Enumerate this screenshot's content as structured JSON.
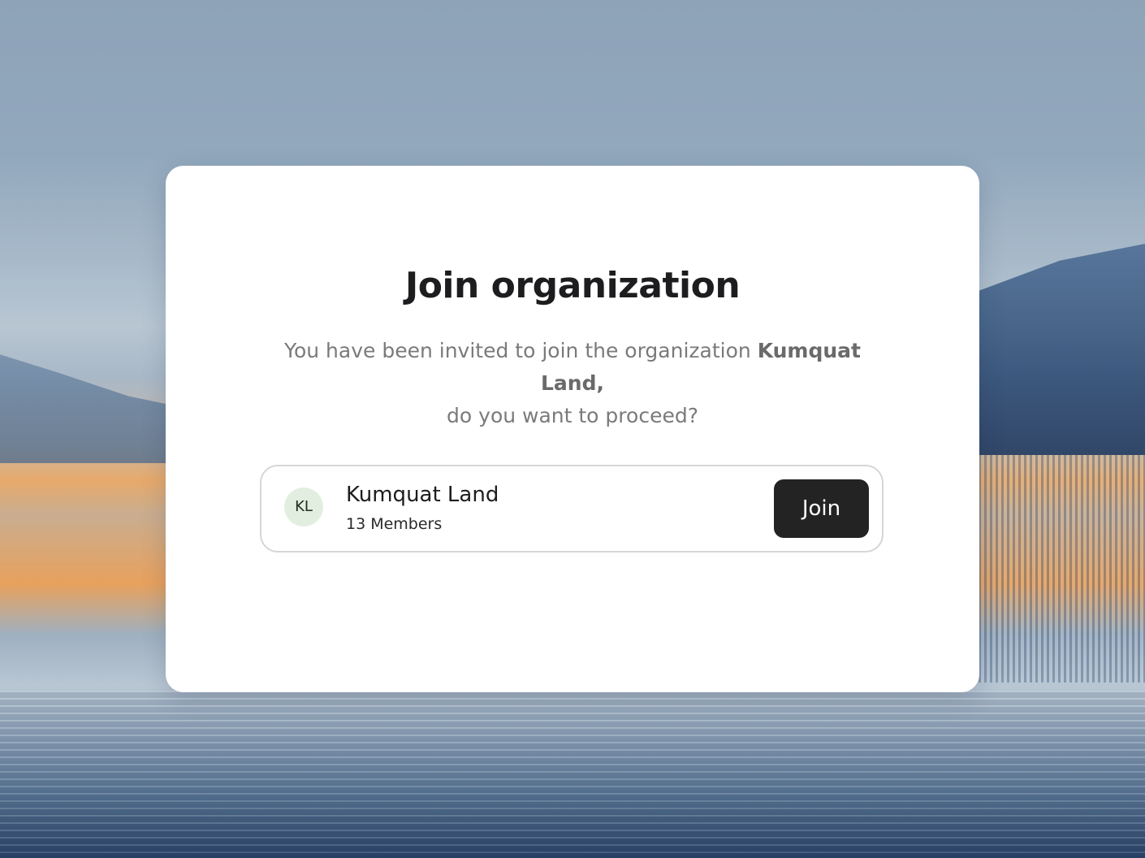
{
  "dialog": {
    "title": "Join organization",
    "description_prefix": "You have been invited to join the organization ",
    "organization_highlight": "Kumquat Land,",
    "description_suffix": " do you want to proceed?"
  },
  "organization": {
    "initials": "KL",
    "name": "Kumquat Land",
    "members": "13 Members",
    "join_label": "Join"
  },
  "colors": {
    "button_bg": "#232323",
    "avatar_bg": "#e2efe0",
    "card_bg": "#ffffff"
  }
}
